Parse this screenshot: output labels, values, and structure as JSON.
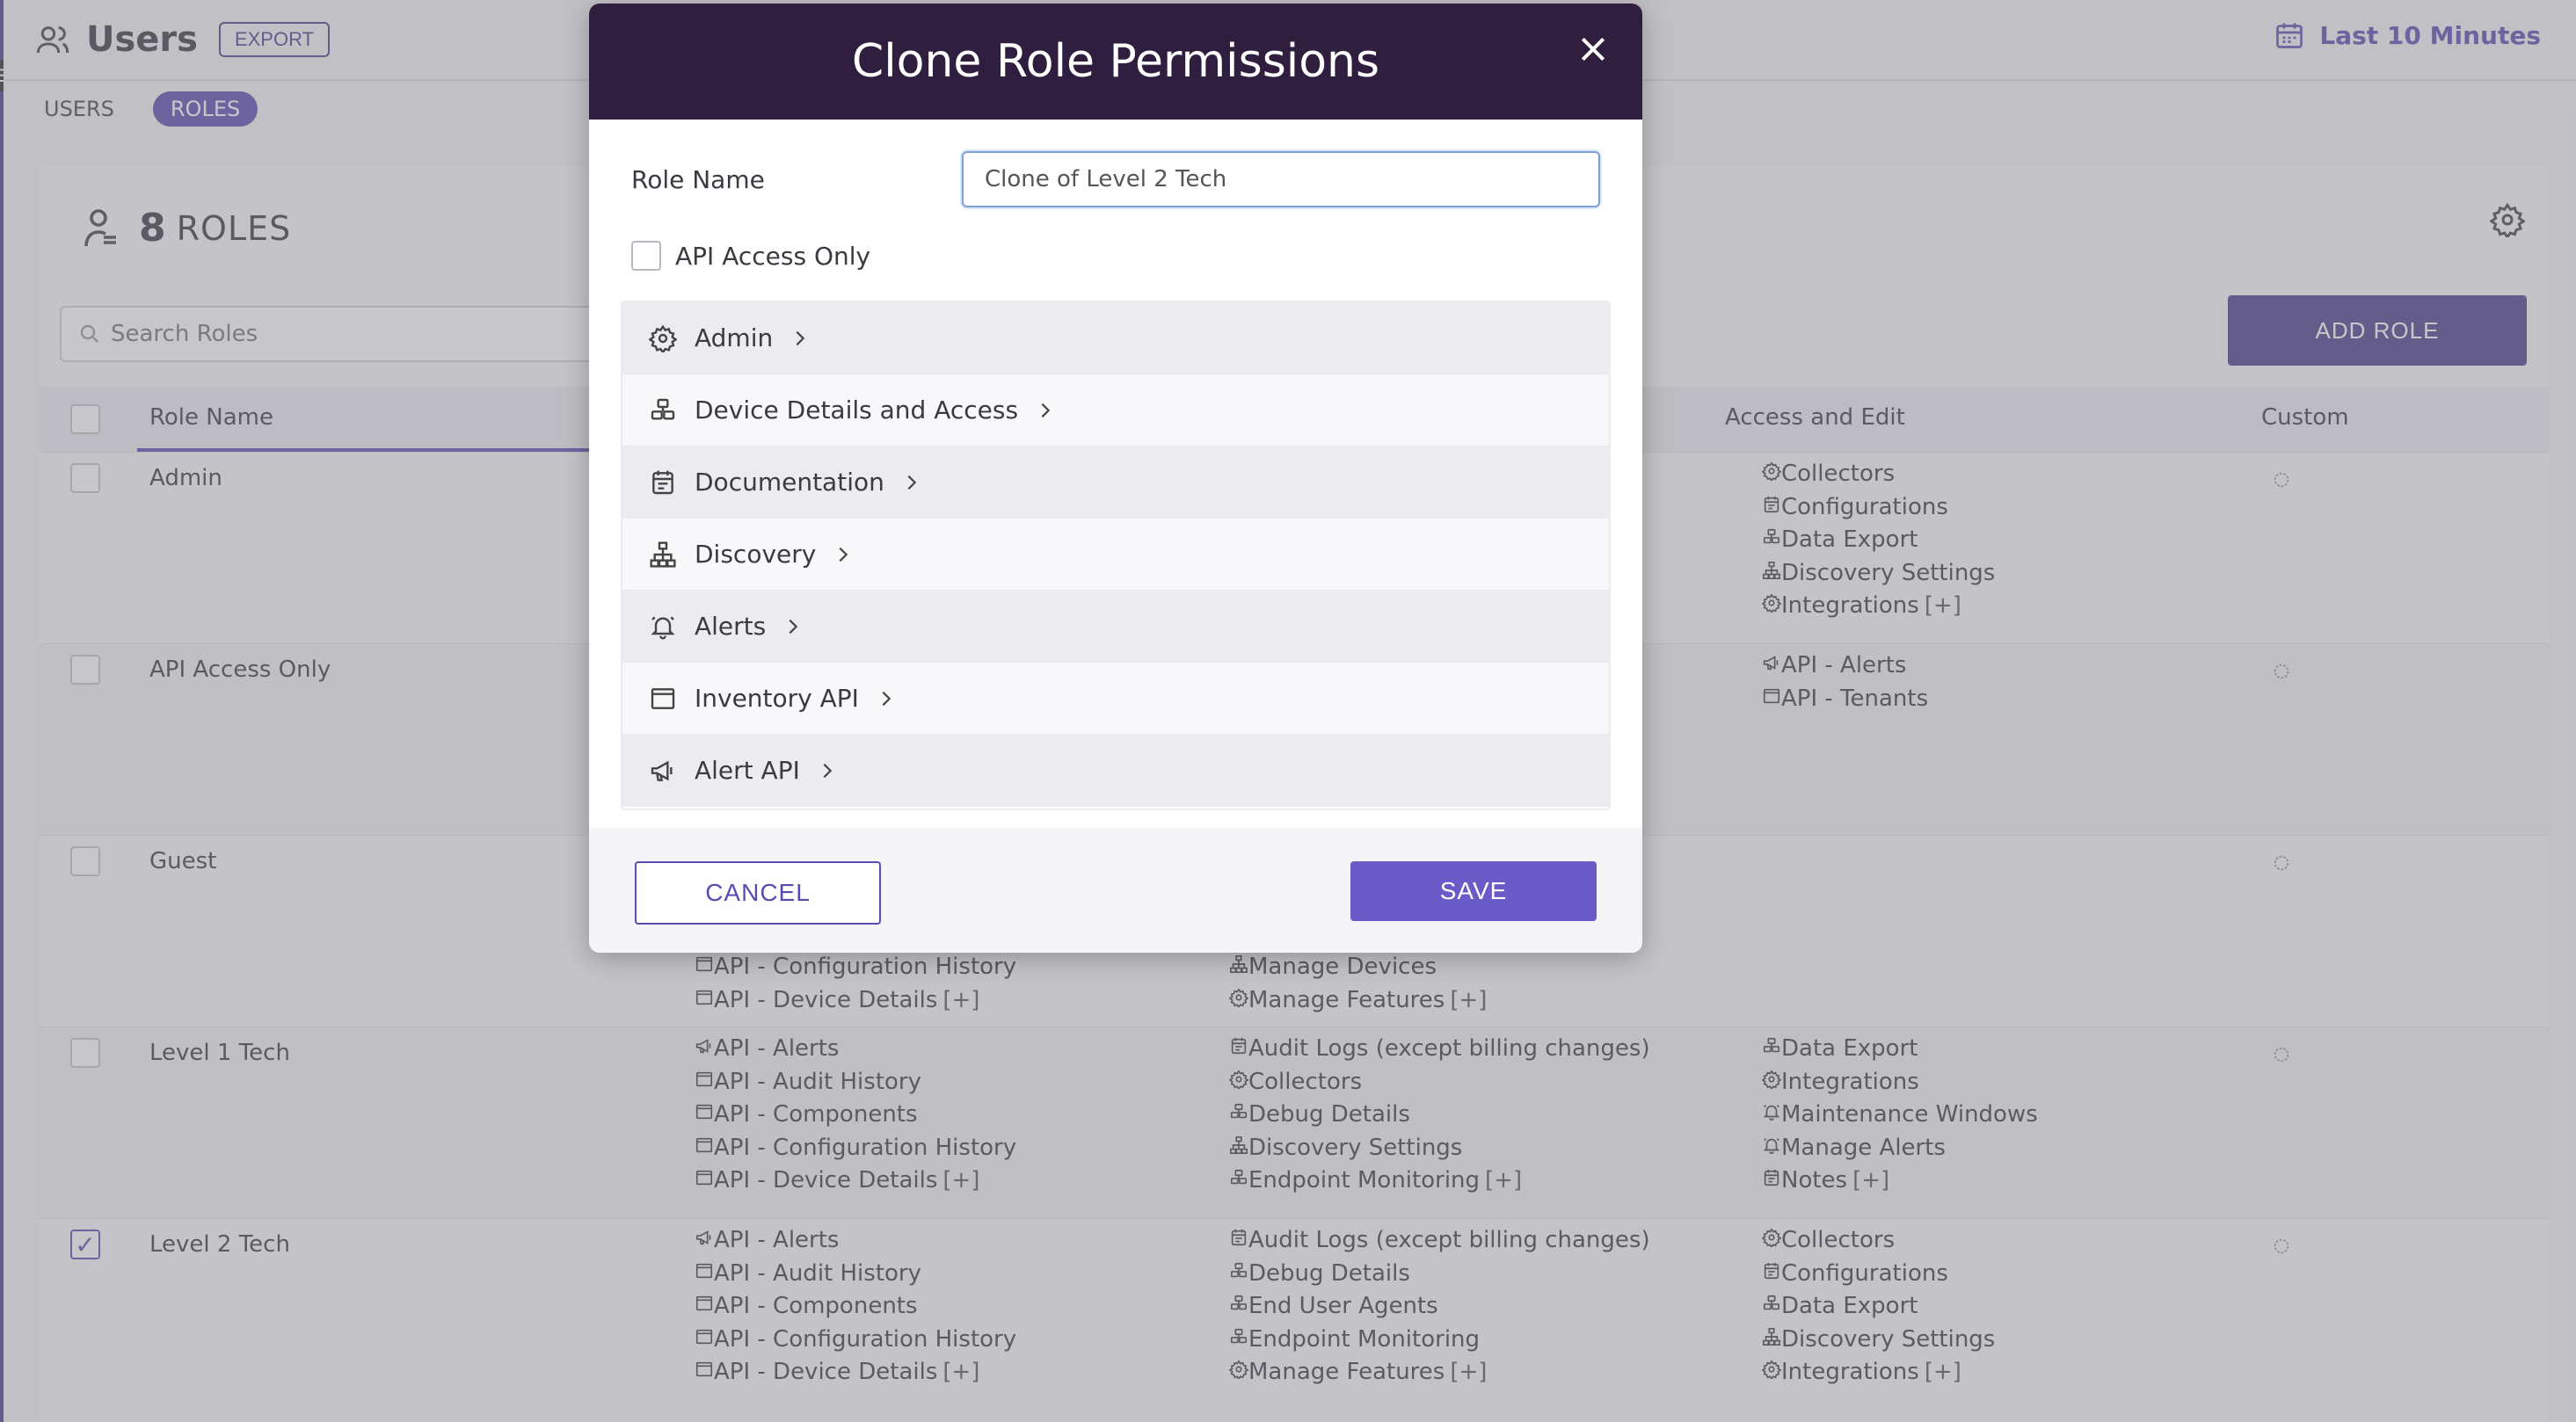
{
  "header": {
    "title": "Users",
    "export_label": "EXPORT",
    "time_range": "Last 10 Minutes"
  },
  "subnav": {
    "tabs": [
      {
        "label": "USERS",
        "active": false
      },
      {
        "label": "ROLES",
        "active": true
      }
    ]
  },
  "roles_panel": {
    "count": "8",
    "count_label": "ROLES",
    "search_placeholder": "Search Roles",
    "add_role_label": "ADD ROLE",
    "columns": {
      "role_name": "Role Name",
      "access_edit": "Access and Edit",
      "custom": "Custom"
    },
    "rows": [
      {
        "name": "Admin",
        "checked": false,
        "col1": [],
        "col2": [],
        "col3": [
          {
            "icon": "gear-icon",
            "text": "Collectors"
          },
          {
            "icon": "document-icon",
            "text": "Configurations"
          },
          {
            "icon": "device-icon",
            "text": "Data Export"
          },
          {
            "icon": "network-icon",
            "text": "Discovery Settings"
          },
          {
            "icon": "gear-icon",
            "text": "Integrations",
            "more": "[+]"
          }
        ]
      },
      {
        "name": "API Access Only",
        "checked": false,
        "col1": [],
        "col2": [],
        "col3": [
          {
            "icon": "megaphone-icon",
            "text": "API - Alerts"
          },
          {
            "icon": "window-icon",
            "text": "API - Tenants"
          }
        ]
      },
      {
        "name": "Guest",
        "checked": false,
        "col1": [
          {
            "icon": "window-icon",
            "text": "API - Configuration History"
          },
          {
            "icon": "window-icon",
            "text": "API - Device Details",
            "more": "[+]"
          }
        ],
        "col2": [
          {
            "icon": "network-icon",
            "text": "Manage Devices"
          },
          {
            "icon": "gear-icon",
            "text": "Manage Features",
            "more": "[+]"
          }
        ],
        "col3": []
      },
      {
        "name": "Level 1 Tech",
        "checked": false,
        "col1": [
          {
            "icon": "megaphone-icon",
            "text": "API - Alerts"
          },
          {
            "icon": "window-icon",
            "text": "API - Audit History"
          },
          {
            "icon": "window-icon",
            "text": "API - Components"
          },
          {
            "icon": "window-icon",
            "text": "API - Configuration History"
          },
          {
            "icon": "window-icon",
            "text": "API - Device Details",
            "more": "[+]"
          }
        ],
        "col2": [
          {
            "icon": "document-icon",
            "text": "Audit Logs (except billing changes)"
          },
          {
            "icon": "gear-icon",
            "text": "Collectors"
          },
          {
            "icon": "device-icon",
            "text": "Debug Details"
          },
          {
            "icon": "network-icon",
            "text": "Discovery Settings"
          },
          {
            "icon": "device-icon",
            "text": "Endpoint Monitoring",
            "more": "[+]"
          }
        ],
        "col3": [
          {
            "icon": "device-icon",
            "text": "Data Export"
          },
          {
            "icon": "gear-icon",
            "text": "Integrations"
          },
          {
            "icon": "bell-icon",
            "text": "Maintenance Windows"
          },
          {
            "icon": "bell-icon",
            "text": "Manage Alerts"
          },
          {
            "icon": "document-icon",
            "text": "Notes",
            "more": "[+]"
          }
        ]
      },
      {
        "name": "Level 2 Tech",
        "checked": true,
        "col1": [
          {
            "icon": "megaphone-icon",
            "text": "API - Alerts"
          },
          {
            "icon": "window-icon",
            "text": "API - Audit History"
          },
          {
            "icon": "window-icon",
            "text": "API - Components"
          },
          {
            "icon": "window-icon",
            "text": "API - Configuration History"
          },
          {
            "icon": "window-icon",
            "text": "API - Device Details",
            "more": "[+]"
          }
        ],
        "col2": [
          {
            "icon": "document-icon",
            "text": "Audit Logs (except billing changes)"
          },
          {
            "icon": "device-icon",
            "text": "Debug Details"
          },
          {
            "icon": "device-icon",
            "text": "End User Agents"
          },
          {
            "icon": "device-icon",
            "text": "Endpoint Monitoring"
          },
          {
            "icon": "gear-icon",
            "text": "Manage Features",
            "more": "[+]"
          }
        ],
        "col3": [
          {
            "icon": "gear-icon",
            "text": "Collectors"
          },
          {
            "icon": "document-icon",
            "text": "Configurations"
          },
          {
            "icon": "device-icon",
            "text": "Data Export"
          },
          {
            "icon": "network-icon",
            "text": "Discovery Settings"
          },
          {
            "icon": "gear-icon",
            "text": "Integrations",
            "more": "[+]"
          }
        ]
      }
    ]
  },
  "modal": {
    "title": "Clone Role Permissions",
    "role_name_label": "Role Name",
    "role_name_value": "Clone of Level 2 Tech",
    "api_access_label": "API Access Only",
    "api_access_checked": false,
    "permission_groups": [
      {
        "label": "Admin",
        "icon": "gear-icon"
      },
      {
        "label": "Device Details and Access",
        "icon": "device-icon"
      },
      {
        "label": "Documentation",
        "icon": "document-icon"
      },
      {
        "label": "Discovery",
        "icon": "network-icon"
      },
      {
        "label": "Alerts",
        "icon": "bell-icon"
      },
      {
        "label": "Inventory API",
        "icon": "window-icon"
      },
      {
        "label": "Alert API",
        "icon": "megaphone-icon"
      }
    ],
    "cancel_label": "CANCEL",
    "save_label": "SAVE"
  },
  "colors": {
    "accent": "#5b4bb0",
    "modal_header": "#2f1e3e",
    "save_button": "#6a5bc8"
  }
}
